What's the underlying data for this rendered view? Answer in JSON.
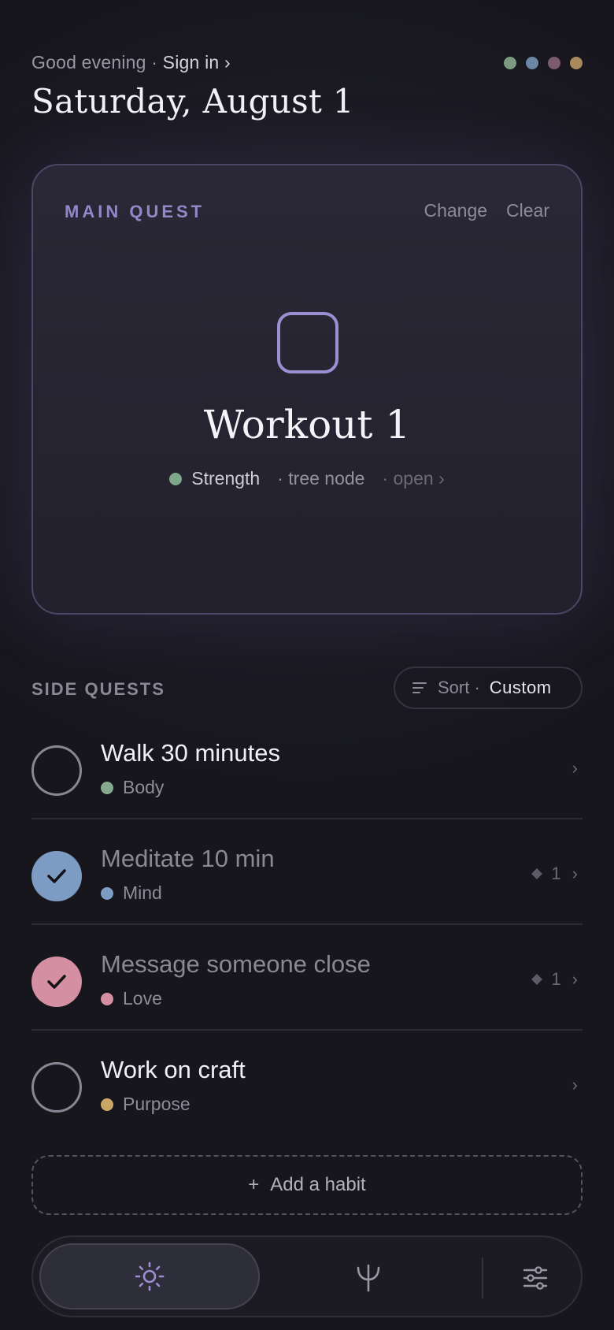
{
  "header": {
    "greeting": "Good evening",
    "separator": "·",
    "sign_in": "Sign in ›",
    "date": "Saturday, August 1",
    "theme_colors": [
      "#7d9a82",
      "#6d86a6",
      "#7c5b6c",
      "#a88a5e"
    ]
  },
  "main_quest": {
    "label": "MAIN QUEST",
    "change": "Change",
    "clear": "Clear",
    "title": "Workout 1",
    "category": "Strength",
    "category_color": "#7fa88a",
    "node": "· tree node",
    "open": "· open ›"
  },
  "side_quests": {
    "label": "SIDE QUESTS",
    "sort_label": "Sort ·",
    "sort_value": "Custom",
    "items": [
      {
        "title": "Walk 30 minutes",
        "category": "Body",
        "color": "#85a98c",
        "done": false,
        "streak": "",
        "chevron": "›"
      },
      {
        "title": "Meditate 10 min",
        "category": "Mind",
        "color": "#7d9cc4",
        "done": true,
        "streak": "1",
        "chevron": "›"
      },
      {
        "title": "Message someone close",
        "category": "Love",
        "color": "#d48fa2",
        "done": true,
        "streak": "1",
        "chevron": "›"
      },
      {
        "title": "Work on craft",
        "category": "Purpose",
        "color": "#caa765",
        "done": false,
        "streak": "",
        "chevron": "›"
      }
    ]
  },
  "add_habit": {
    "icon": "+",
    "label": "Add a habit"
  },
  "tabbar": {
    "today_icon": "sun-icon",
    "tree_icon": "tree-branch-icon",
    "settings_icon": "sliders-icon",
    "accent": "#9b8ed1"
  }
}
